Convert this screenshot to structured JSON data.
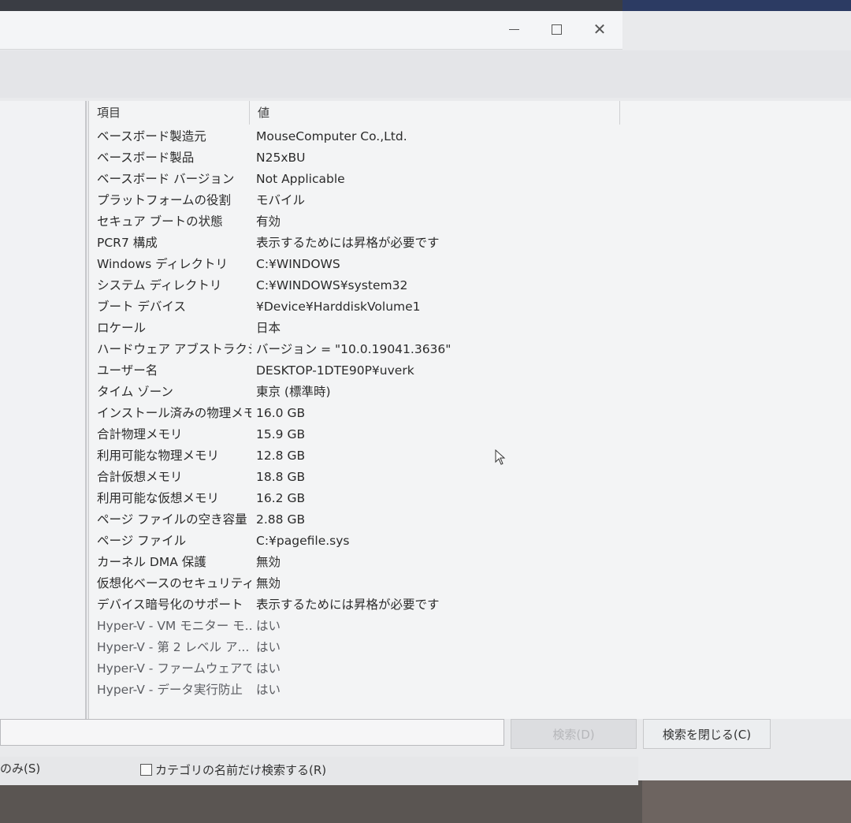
{
  "window": {
    "controls": {
      "minimize": "",
      "maximize": "",
      "close": "✕"
    }
  },
  "list": {
    "headers": {
      "item": "項目",
      "value": "値"
    },
    "rows": [
      {
        "item": "ベースボード製造元",
        "value": "MouseComputer Co.,Ltd."
      },
      {
        "item": "ベースボード製品",
        "value": "N25xBU"
      },
      {
        "item": "ベースボード バージョン",
        "value": "Not Applicable"
      },
      {
        "item": "プラットフォームの役割",
        "value": "モバイル"
      },
      {
        "item": "セキュア ブートの状態",
        "value": "有効"
      },
      {
        "item": "PCR7 構成",
        "value": "表示するためには昇格が必要です"
      },
      {
        "item": "Windows ディレクトリ",
        "value": "C:¥WINDOWS"
      },
      {
        "item": "システム ディレクトリ",
        "value": "C:¥WINDOWS¥system32"
      },
      {
        "item": "ブート デバイス",
        "value": "¥Device¥HarddiskVolume1"
      },
      {
        "item": "ロケール",
        "value": "日本"
      },
      {
        "item": "ハードウェア アブストラクショ...",
        "value": "バージョン = \"10.0.19041.3636\""
      },
      {
        "item": "ユーザー名",
        "value": "DESKTOP-1DTE90P¥uverk"
      },
      {
        "item": "タイム ゾーン",
        "value": "東京 (標準時)"
      },
      {
        "item": "インストール済みの物理メモ...",
        "value": "16.0 GB"
      },
      {
        "item": "合計物理メモリ",
        "value": "15.9 GB"
      },
      {
        "item": "利用可能な物理メモリ",
        "value": "12.8 GB"
      },
      {
        "item": "合計仮想メモリ",
        "value": "18.8 GB"
      },
      {
        "item": "利用可能な仮想メモリ",
        "value": "16.2 GB"
      },
      {
        "item": "ページ ファイルの空き容量",
        "value": "2.88 GB"
      },
      {
        "item": "ページ ファイル",
        "value": "C:¥pagefile.sys"
      },
      {
        "item": "カーネル DMA 保護",
        "value": "無効"
      },
      {
        "item": "仮想化ベースのセキュリティ",
        "value": "無効"
      },
      {
        "item": "デバイス暗号化のサポート",
        "value": "表示するためには昇格が必要です"
      },
      {
        "item": "Hyper-V - VM モニター モ...",
        "value": "はい"
      },
      {
        "item": "Hyper-V - 第 2 レベル ア...",
        "value": "はい"
      },
      {
        "item": "Hyper-V - ファームウェアで...",
        "value": "はい"
      },
      {
        "item": "Hyper-V - データ実行防止",
        "value": "はい"
      }
    ]
  },
  "search": {
    "input_value": "",
    "search_button": "検索(D)",
    "close_button": "検索を閉じる(C)"
  },
  "options": {
    "left_label": "のみ(S)",
    "category_only": "カテゴリの名前だけ検索する(R)"
  }
}
